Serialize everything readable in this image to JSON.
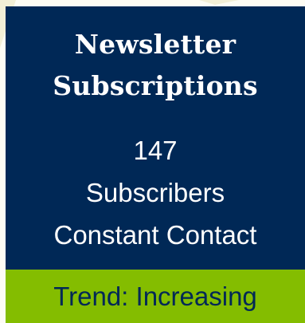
{
  "card": {
    "title_line1": "Newsletter",
    "title_line2": "Subscriptions",
    "count": "147",
    "unit": "Subscribers",
    "source": "Constant Contact",
    "trend": "Trend: Increasing"
  },
  "colors": {
    "card_background": "#002856",
    "footer_background": "#84bd00",
    "title_text": "#ffffff",
    "footer_text": "#002856",
    "page_background": "#fdfcf4"
  }
}
